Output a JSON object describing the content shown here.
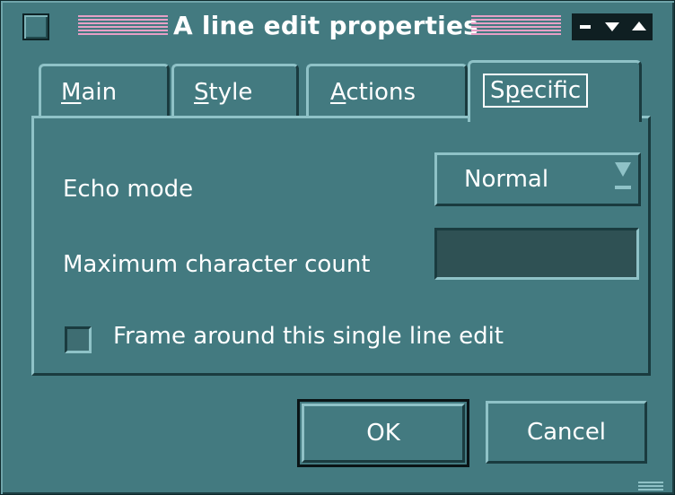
{
  "window": {
    "title": "A line edit properties"
  },
  "tabs": [
    {
      "label": "Main",
      "mnemonic": "M",
      "rest": "ain"
    },
    {
      "label": "Style",
      "mnemonic": "S",
      "rest": "tyle"
    },
    {
      "label": "Actions",
      "mnemonic": "A",
      "rest": "ctions"
    },
    {
      "label": "Specific",
      "pre": "S",
      "mnemonic": "p",
      "rest": "ecific",
      "active": true
    }
  ],
  "specific": {
    "echo_mode_label": "Echo mode",
    "echo_mode_value": "Normal",
    "max_count_label": "Maximum character count",
    "max_count_value": "",
    "frame_label": "Frame around this single line edit",
    "frame_checked": false
  },
  "buttons": {
    "ok": "OK",
    "cancel": "Cancel"
  },
  "colors": {
    "background": "#437a80",
    "title_stripes": "#e6a0c6",
    "text": "#ffffff"
  },
  "icons": [
    "system-menu-icon",
    "minimize-icon",
    "shade-icon",
    "maximize-icon",
    "dropdown-arrow-icon",
    "resize-grip-icon"
  ]
}
